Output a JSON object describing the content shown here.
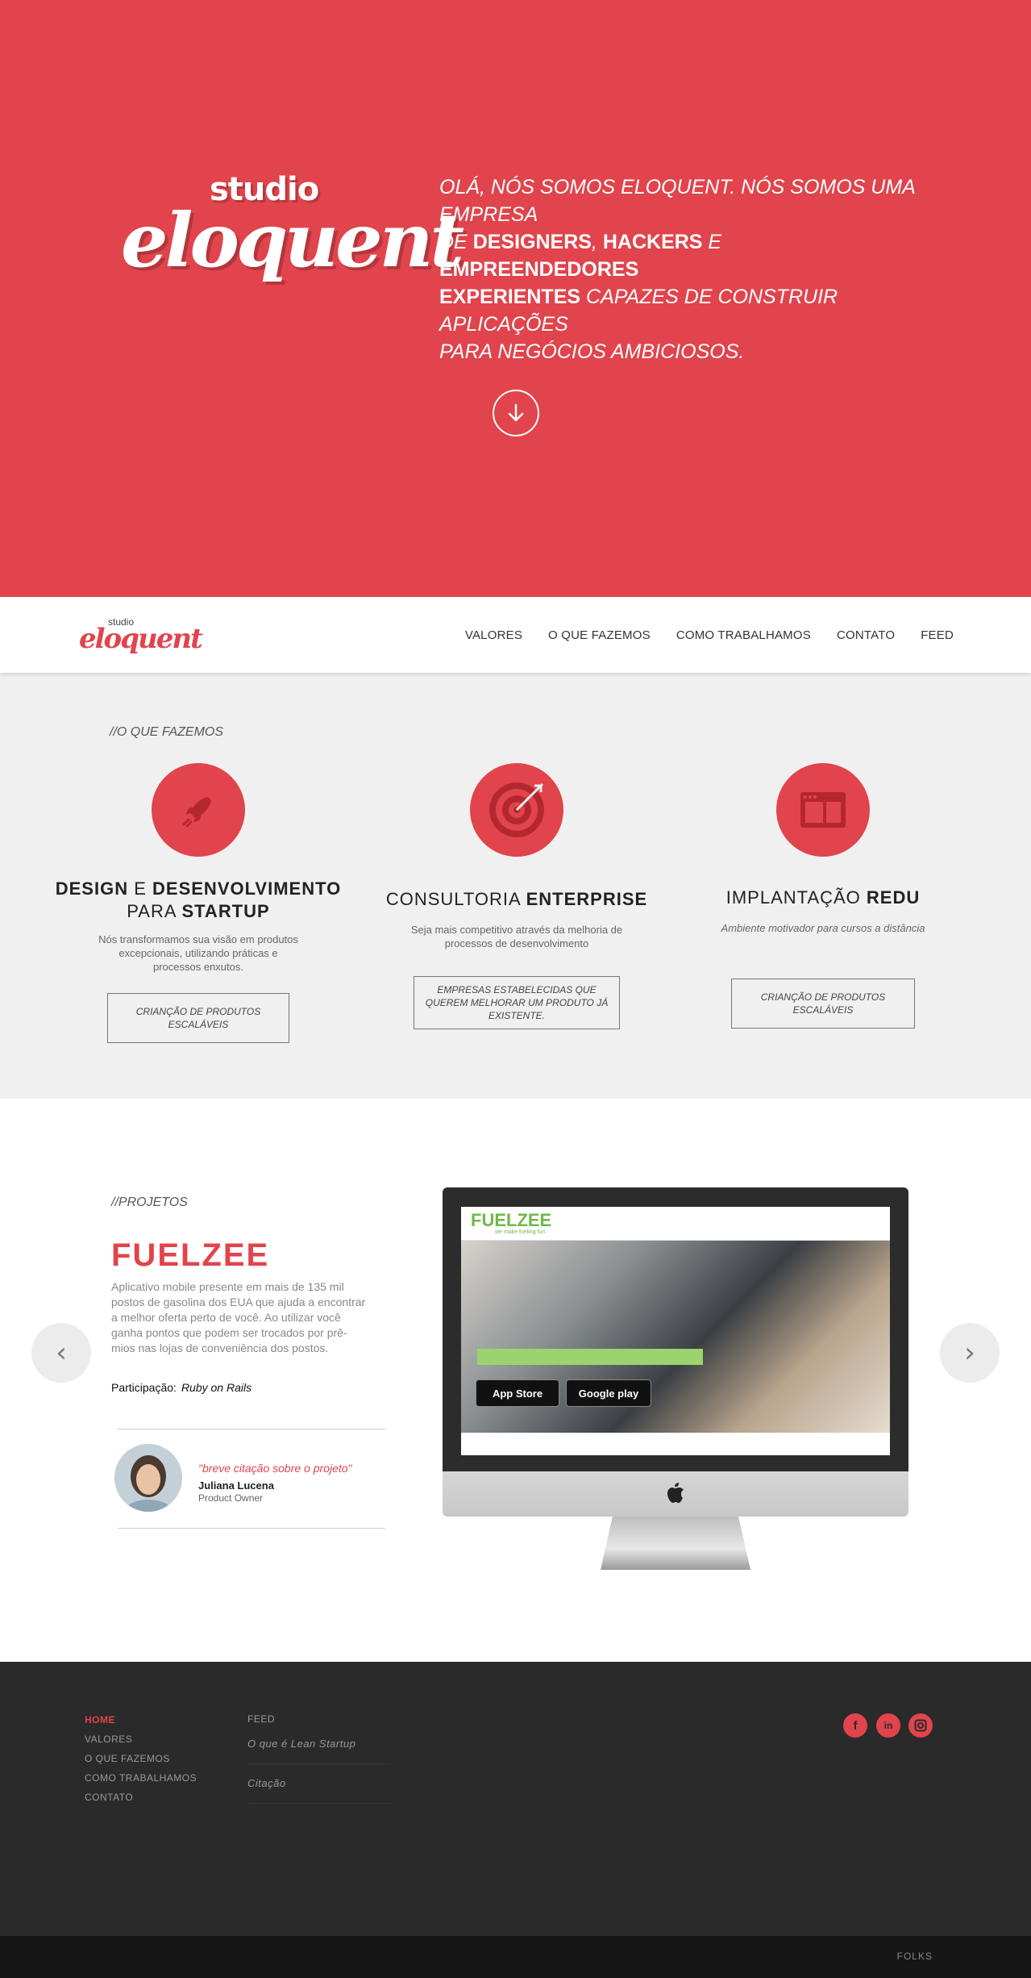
{
  "hero": {
    "logo_small": "studio",
    "logo_big": "eloquent",
    "tagline": {
      "line1": "OLÁ, NÓS SOMOS ELOQUENT. NÓS SOMOS UMA EMPRESA",
      "l2_a": "DE ",
      "l2_b": "DESIGNERS",
      "l2_c": ", ",
      "l2_d": "HACKERS",
      "l2_e": " E ",
      "l2_f": "EMPREENDEDORES",
      "l3_a": "EXPERIENTES",
      "l3_b": " CAPAZES DE CONSTRUIR APLICAÇÕES",
      "line4": "PARA NEGÓCIOS AMBICIOSOS."
    },
    "scroll_icon": "arrow-down-circle-icon"
  },
  "nav": {
    "logo_small": "studio",
    "logo_big": "eloquent",
    "links": [
      "VALORES",
      "O QUE FAZEMOS",
      "COMO TRABALHAMOS",
      "CONTATO",
      "FEED"
    ]
  },
  "services": {
    "label": "//O QUE FAZEMOS",
    "items": [
      {
        "icon": "rocket-icon",
        "title_a": "DESIGN",
        "title_b": " E ",
        "title_c": "DESENVOLVIMENTO",
        "title_d": "PARA ",
        "title_e": "STARTUP",
        "desc": "Nós transformamos sua visão em produtos excepcionais, utilizando práticas e processos enxutos.",
        "button": "CRIANÇÃO DE PRODUTOS ESCALÁVEIS"
      },
      {
        "icon": "target-icon",
        "title_a": "CONSULTORIA ",
        "title_b": "ENTERPRISE",
        "desc": "Seja mais competitivo através da melhoria de processos de desenvolvimento",
        "button": "EMPRESAS ESTABELECIDAS QUE QUEREM MELHORAR UM PRODUTO JÁ EXISTENTE."
      },
      {
        "icon": "browser-window-icon",
        "title_a": "IMPLANTAÇÃO ",
        "title_b": "REDU",
        "desc": "Ambiente motivador para cursos a distância",
        "button": "CRIANÇÃO DE PRODUTOS ESCALÁVEIS"
      }
    ]
  },
  "projects": {
    "label": "//PROJETOS",
    "title": "FUELZEE",
    "desc": "Aplicativo mobile presente em mais de 135 mil postos de gasolina dos EUA que ajuda a encontrar a melhor oferta perto de você. Ao utilizar você ganha pontos que podem ser trocados por prê-mios nas lojas de conveniência dos postos.",
    "participation_label": "Participação:",
    "participation_value": "Ruby on Rails",
    "quote": "\"breve citação sobre o projeto\"",
    "quote_name": "Juliana Lucena",
    "quote_role": "Product Owner",
    "prev_icon": "chevron-left-icon",
    "next_icon": "chevron-right-icon",
    "screen": {
      "logo": "FUELZEE",
      "tagline": "we make fueling fun",
      "appstore": "App Store",
      "googleplay": "Google play"
    }
  },
  "footer": {
    "menu": [
      "HOME",
      "VALORES",
      "O QUE FAZEMOS",
      "COMO TRABALHAMOS",
      "CONTATO"
    ],
    "feed_label": "FEED",
    "feed_items": [
      "O que é Lean Startup",
      "Citação"
    ],
    "social": [
      "f",
      "in",
      "ig"
    ],
    "bottom": "FOLKS"
  },
  "colors": {
    "accent": "#e1444c",
    "footer_bg": "#2a2a2a",
    "green": "#6fb84a"
  }
}
